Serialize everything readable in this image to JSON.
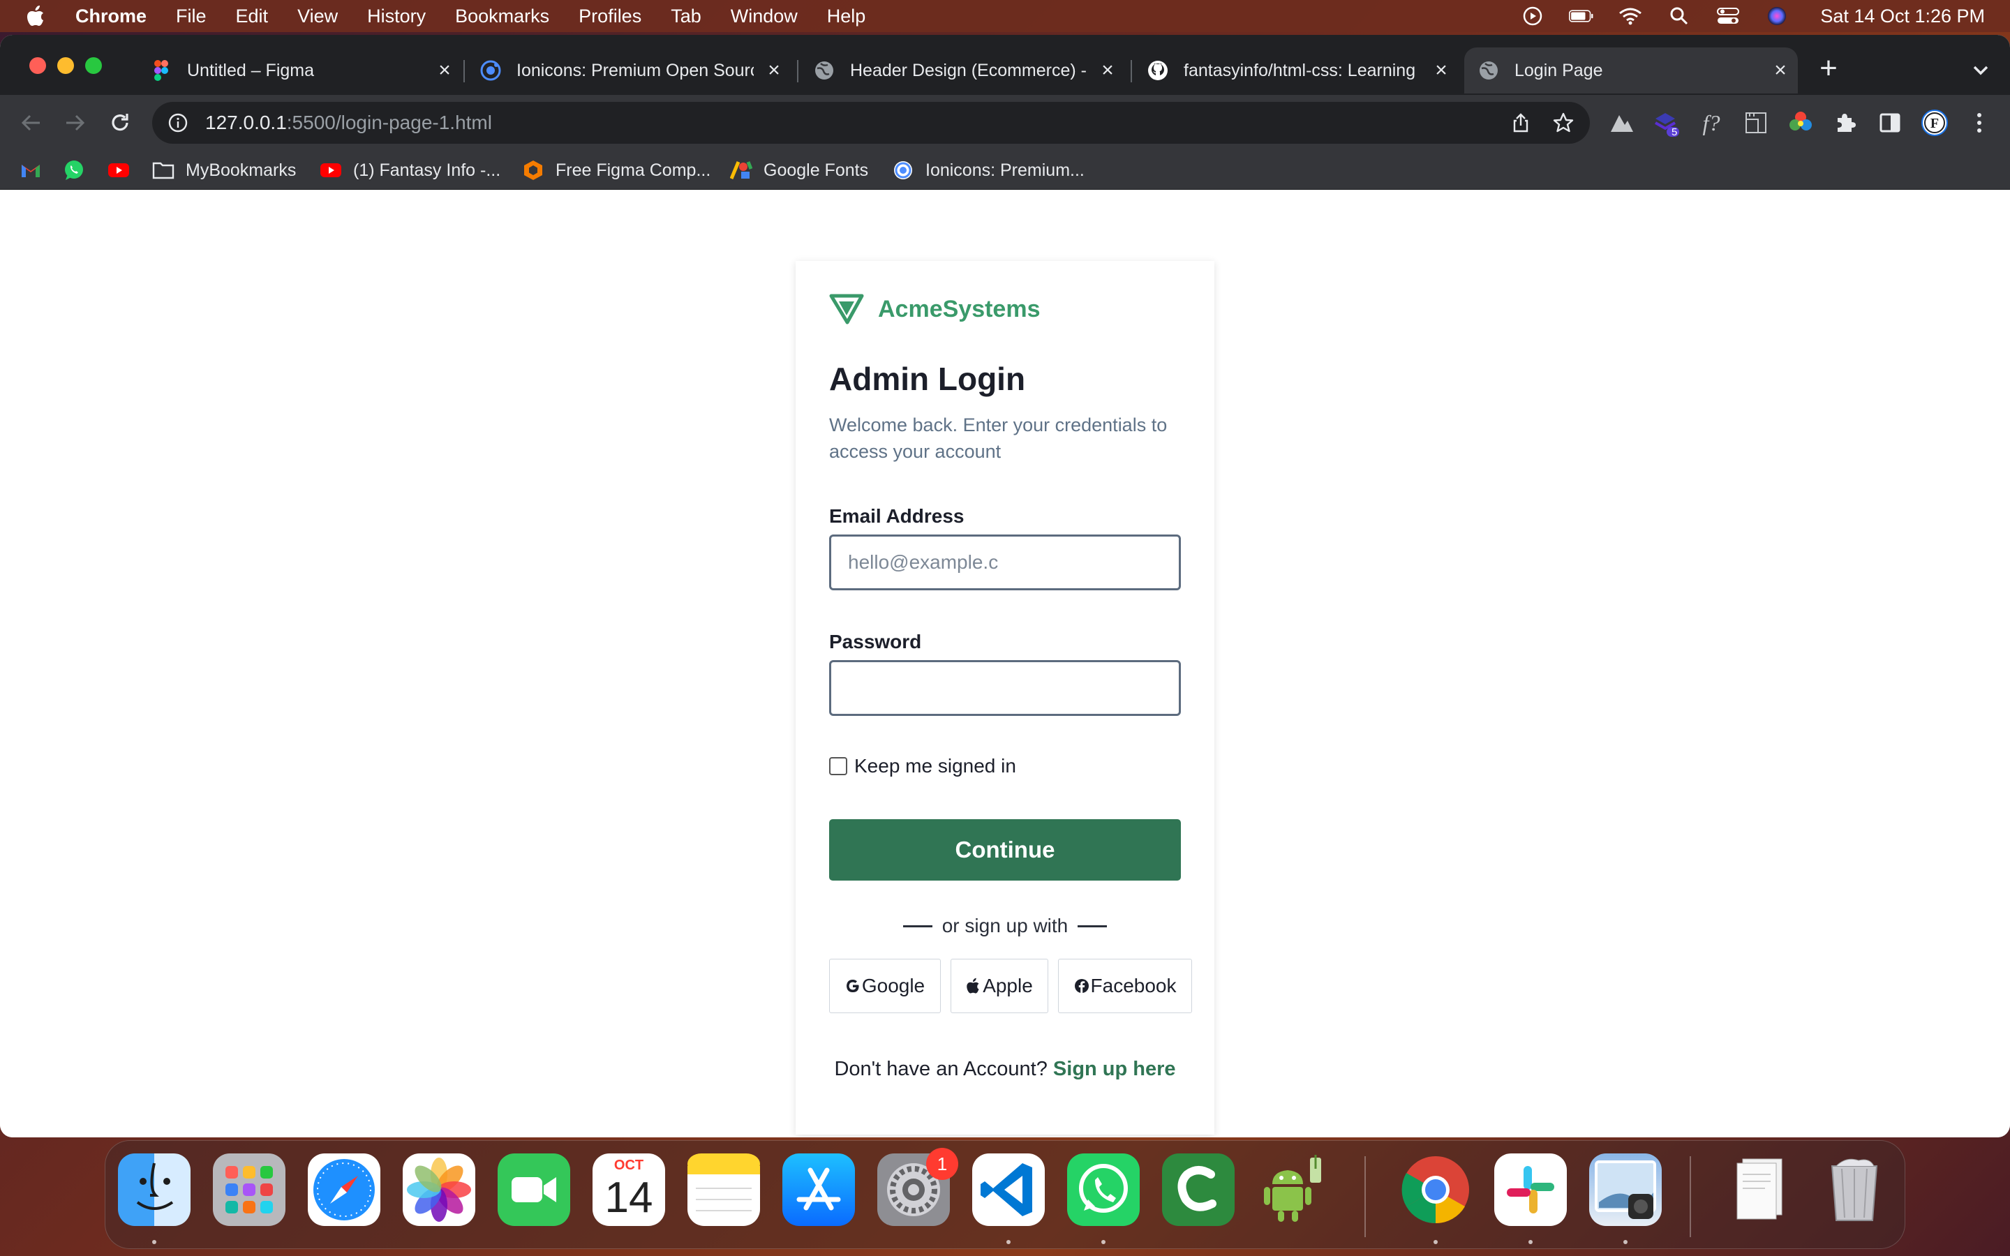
{
  "menubar": {
    "app_name": "Chrome",
    "menus": [
      "File",
      "Edit",
      "View",
      "History",
      "Bookmarks",
      "Profiles",
      "Tab",
      "Window",
      "Help"
    ],
    "clock": "Sat 14 Oct  1:26 PM"
  },
  "tabs": [
    {
      "title": "Untitled – Figma",
      "icon": "figma-icon"
    },
    {
      "title": "Ionicons: Premium Open Source",
      "icon": "ionicons-icon"
    },
    {
      "title": "Header Design (Ecommerce) -",
      "icon": "globe-icon"
    },
    {
      "title": "fantasyinfo/html-css: Learning",
      "icon": "github-icon"
    },
    {
      "title": "Login Page",
      "icon": "globe-icon",
      "active": true
    }
  ],
  "omnibox": {
    "host": "127.0.0.1",
    "path": ":5500/login-page-1.html"
  },
  "bookmarks": [
    {
      "label": "",
      "icon": "gmail-icon"
    },
    {
      "label": "",
      "icon": "whatsapp-icon"
    },
    {
      "label": "",
      "icon": "youtube-icon"
    },
    {
      "label": "MyBookmarks",
      "icon": "folder-icon"
    },
    {
      "label": "(1) Fantasy Info -...",
      "icon": "youtube-icon"
    },
    {
      "label": "Free Figma Comp...",
      "icon": "hexagon-icon"
    },
    {
      "label": "Google Fonts",
      "icon": "google-fonts-icon"
    },
    {
      "label": "Ionicons: Premium...",
      "icon": "ionicons-icon"
    }
  ],
  "login": {
    "brand": "AcmeSystems",
    "heading": "Admin Login",
    "subtitle": "Welcome back. Enter your credentials to access your account",
    "email_label": "Email Address",
    "email_placeholder": "hello@example.c",
    "email_value": "",
    "password_label": "Password",
    "password_value": "",
    "remember_label": "Keep me signed in",
    "remember_checked": false,
    "continue_label": "Continue",
    "divider_text": "or sign up with",
    "social": {
      "google": "Google",
      "apple": "Apple",
      "facebook": "Facebook"
    },
    "signup_prompt": "Don't have an Account?",
    "signup_link": "Sign up here"
  },
  "colors": {
    "accent": "#307554",
    "brand_text": "#3a9a6a",
    "subtitle": "#5f7287"
  },
  "dock": {
    "calendar_month": "OCT",
    "calendar_day": "14",
    "settings_badge": "1",
    "extension_badge": "5"
  }
}
